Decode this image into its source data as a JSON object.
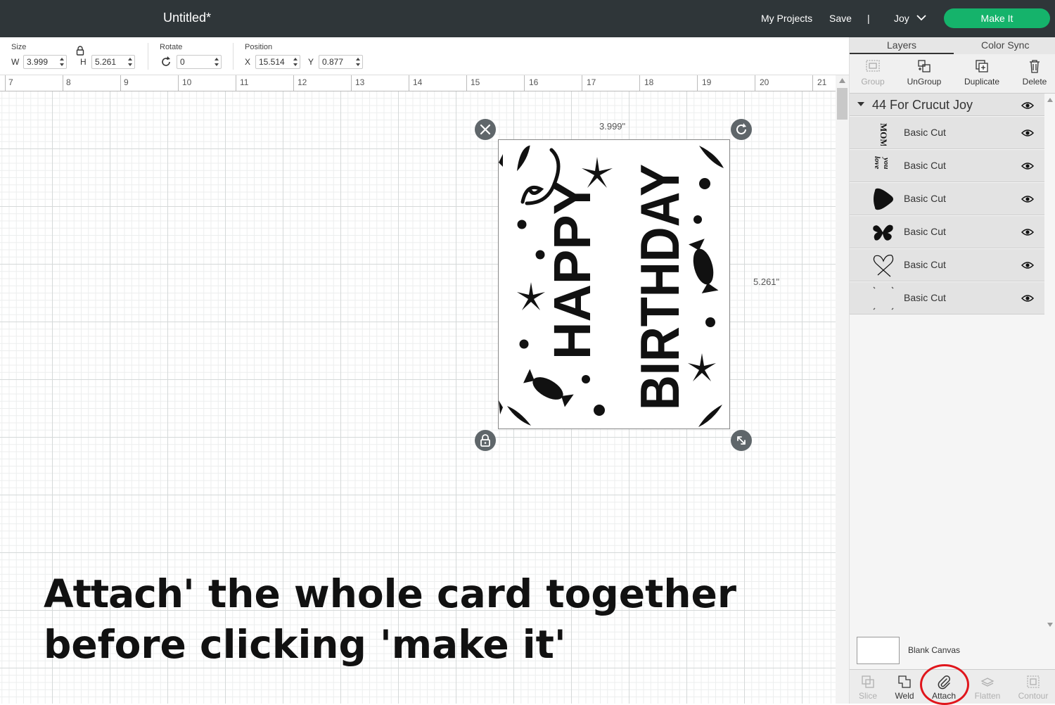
{
  "app": {
    "title": "Untitled*",
    "nav": {
      "my_projects": "My Projects",
      "save": "Save",
      "separator": "|",
      "machine": "Joy"
    },
    "make_it": "Make It",
    "colors": {
      "topbar": "#2f3639",
      "make_it": "#15b36b",
      "annotation_circle": "#e0161c"
    }
  },
  "toolbar": {
    "size": {
      "label": "Size",
      "w_letter": "W",
      "w_value": "3.999",
      "h_letter": "H",
      "h_value": "5.261"
    },
    "rotate": {
      "label": "Rotate",
      "value": "0"
    },
    "position": {
      "label": "Position",
      "x_letter": "X",
      "x_value": "15.514",
      "y_letter": "Y",
      "y_value": "0.877"
    }
  },
  "ruler": {
    "marks": [
      "7",
      "8",
      "9",
      "10",
      "11",
      "12",
      "13",
      "14",
      "15",
      "16",
      "17",
      "18",
      "19",
      "20",
      "21"
    ]
  },
  "selection": {
    "width_label": "3.999\"",
    "height_label": "5.261\"",
    "card_text": {
      "line1": "HAPPY",
      "line2": "BIRTHDAY"
    }
  },
  "caption": {
    "bold": "Attach",
    "rest": "' the whole card together before clicking 'make it'"
  },
  "panel": {
    "tabs": [
      "Layers",
      "Color Sync"
    ],
    "tools": [
      "Group",
      "UnGroup",
      "Duplicate",
      "Delete"
    ],
    "group_name": "44 For Crucut Joy",
    "layers": [
      {
        "name": "Basic Cut",
        "thumb": "mom-text"
      },
      {
        "name": "Basic Cut",
        "thumb": "love-you-text"
      },
      {
        "name": "Basic Cut",
        "thumb": "heart"
      },
      {
        "name": "Basic Cut",
        "thumb": "butterfly"
      },
      {
        "name": "Basic Cut",
        "thumb": "heart-outline"
      },
      {
        "name": "Basic Cut",
        "thumb": "corners"
      }
    ],
    "blank_canvas": "Blank Canvas",
    "bottom_tools": [
      "Slice",
      "Weld",
      "Attach",
      "Flatten",
      "Contour"
    ]
  }
}
